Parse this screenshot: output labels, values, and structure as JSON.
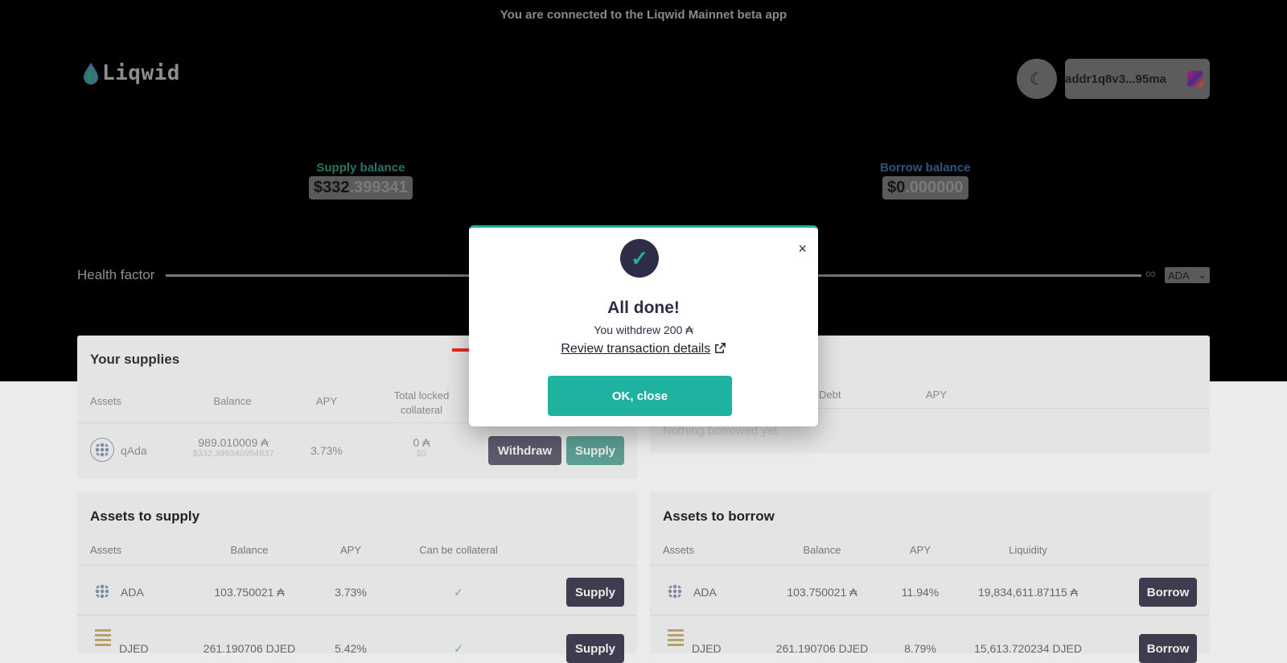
{
  "banner": "You are connected to the Liqwid Mainnet beta app",
  "logo": {
    "name": "Liqwid"
  },
  "header": {
    "theme_icon": "moon-icon",
    "wallet_address": "addr1q8v3...95ma"
  },
  "balances": {
    "supply": {
      "label": "Supply balance",
      "whole": "$332",
      "decimals": ".399341"
    },
    "borrow": {
      "label": "Borrow balance",
      "whole": "$0",
      "decimals": ".000000"
    }
  },
  "health": {
    "label": "Health factor",
    "value": "∞",
    "currency": "ADA"
  },
  "your_supplies": {
    "title": "Your supplies",
    "headers": [
      "Assets",
      "Balance",
      "APY",
      "Total locked collateral"
    ],
    "rows": [
      {
        "asset": "qAda",
        "balance": "989.010009 ₳",
        "balance_usd": "$332.399340954837",
        "apy": "3.73%",
        "locked": "0 ₳",
        "locked_usd": "$0",
        "withdraw": "Withdraw",
        "supply": "Supply"
      }
    ]
  },
  "your_borrows": {
    "headers": [
      "Debt",
      "APY"
    ],
    "empty": "Nothing borrowed yet"
  },
  "assets_to_supply": {
    "title": "Assets to supply",
    "headers": [
      "Assets",
      "Balance",
      "APY",
      "Can be collateral"
    ],
    "rows": [
      {
        "asset": "ADA",
        "balance": "103.750021 ₳",
        "apy": "3.73%",
        "collateral": "✓",
        "action": "Supply"
      },
      {
        "asset": "DJED",
        "balance": "261.190706 DJED",
        "apy": "5.42%",
        "collateral": "✓",
        "action": "Supply"
      }
    ]
  },
  "assets_to_borrow": {
    "title": "Assets to borrow",
    "headers": [
      "Assets",
      "Balance",
      "APY",
      "Liquidity"
    ],
    "rows": [
      {
        "asset": "ADA",
        "balance": "103.750021 ₳",
        "apy": "11.94%",
        "liquidity": "19,834,611.87115 ₳",
        "action": "Borrow"
      },
      {
        "asset": "DJED",
        "balance": "261.190706 DJED",
        "apy": "8.79%",
        "liquidity": "15,613.720234 DJED",
        "action": "Borrow"
      }
    ]
  },
  "modal": {
    "title": "All done!",
    "message": "You withdrew 200 ₳",
    "link": "Review transaction details",
    "ok": "OK, close",
    "close_symbol": "×"
  },
  "colors": {
    "teal": "#1fb2a0",
    "navy": "#2f2c48",
    "arrow": "#e8281e"
  }
}
